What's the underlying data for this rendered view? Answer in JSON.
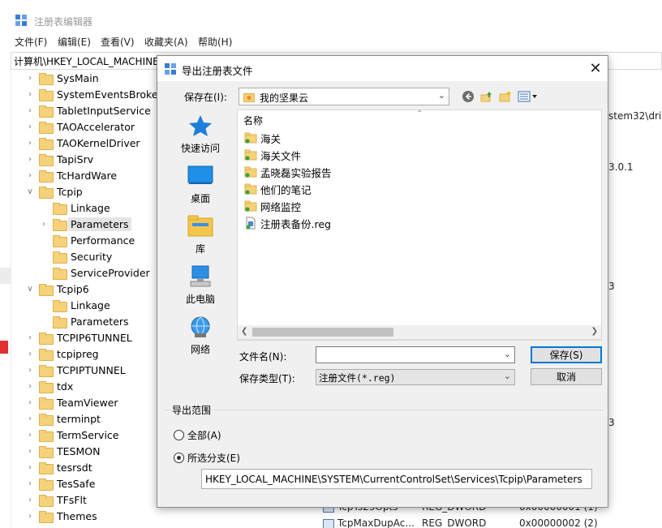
{
  "regedit": {
    "title": "注册表编辑器",
    "menu": [
      "文件(F)",
      "编辑(E)",
      "查看(V)",
      "收藏夹(A)",
      "帮助(H)"
    ],
    "address": "计算机\\HKEY_LOCAL_MACHINE",
    "tree": [
      {
        "label": "SysMain",
        "expanded": false
      },
      {
        "label": "SystemEventsBroker",
        "expanded": false
      },
      {
        "label": "TabletInputService",
        "expanded": false
      },
      {
        "label": "TAOAccelerator",
        "expanded": false
      },
      {
        "label": "TAOKernelDriver",
        "expanded": false
      },
      {
        "label": "TapiSrv",
        "expanded": false
      },
      {
        "label": "TcHardWare",
        "expanded": false
      },
      {
        "label": "Tcpip",
        "expanded": true
      },
      {
        "label": "Linkage",
        "expanded": false
      },
      {
        "label": "Parameters",
        "expanded": false,
        "selected": true
      },
      {
        "label": "Performance",
        "expanded": false
      },
      {
        "label": "Security",
        "expanded": false
      },
      {
        "label": "ServiceProvider",
        "expanded": false
      },
      {
        "label": "Tcpip6",
        "expanded": true
      },
      {
        "label": "Linkage",
        "expanded": false
      },
      {
        "label": "Parameters",
        "expanded": false
      },
      {
        "label": "TCPIP6TUNNEL",
        "expanded": false
      },
      {
        "label": "tcpipreg",
        "expanded": false
      },
      {
        "label": "TCPIPTUNNEL",
        "expanded": false
      },
      {
        "label": "tdx",
        "expanded": false
      },
      {
        "label": "TeamViewer",
        "expanded": false
      },
      {
        "label": "terminpt",
        "expanded": false
      },
      {
        "label": "TermService",
        "expanded": false
      },
      {
        "label": "TESMON",
        "expanded": false
      },
      {
        "label": "tesrsdt",
        "expanded": false
      },
      {
        "label": "TesSafe",
        "expanded": false
      },
      {
        "label": "TFsFlt",
        "expanded": false
      },
      {
        "label": "Themes",
        "expanded": false
      }
    ],
    "right_fragments": {
      "frag1": "stem32\\driv",
      "frag2": "3.0.1",
      "frag3": "3",
      "frag4": "3"
    },
    "values": [
      {
        "name": "TcpTs23Opts",
        "type": "REG_DWORD",
        "data": "0x00000001 (1)"
      },
      {
        "name": "TcpMaxDupAc...",
        "type": "REG_DWORD",
        "data": "0x00000002 (2)"
      }
    ]
  },
  "dialog": {
    "title": "导出注册表文件",
    "close_glyph": "✕",
    "save_in_label": "保存在(I):",
    "save_in_value": "我的坚果云",
    "places": [
      "快速访问",
      "桌面",
      "库",
      "此电脑",
      "网络"
    ],
    "list_header": "名称",
    "files": [
      {
        "name": "海关",
        "icon": "sync-folder-icon"
      },
      {
        "name": "海关文件",
        "icon": "sync-folder-icon"
      },
      {
        "name": "孟晓磊实验报告",
        "icon": "sync-folder-icon"
      },
      {
        "name": "他们的笔记",
        "icon": "sync-folder-icon"
      },
      {
        "name": "网络监控",
        "icon": "sync-folder-icon"
      },
      {
        "name": "注册表备份.reg",
        "icon": "reg-file-icon"
      }
    ],
    "filename_label": "文件名(N):",
    "filename_value": "",
    "filetype_label": "保存类型(T):",
    "filetype_value": "注册文件(*.reg)",
    "save_button": "保存(S)",
    "cancel_button": "取消",
    "range_title": "导出范围",
    "radio_all": "全部(A)",
    "radio_branch": "所选分支(E)",
    "selected_radio": "branch",
    "branch_path": "HKEY_LOCAL_MACHINE\\SYSTEM\\CurrentControlSet\\Services\\Tcpip\\Parameters"
  },
  "colors": {
    "accent": "#0078d7",
    "folder": "#f4d27a",
    "dialog_bg": "#f0f0f0"
  }
}
